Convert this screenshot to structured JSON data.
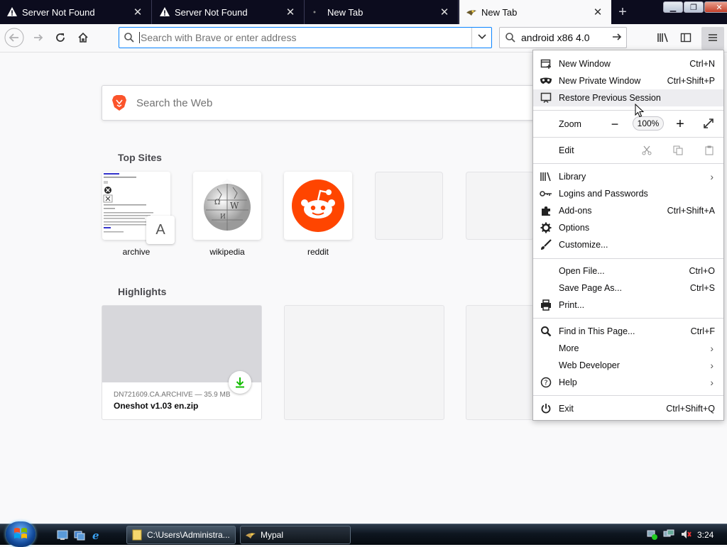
{
  "tabs": [
    {
      "title": "Server Not Found",
      "icon": "warning-icon",
      "active": false
    },
    {
      "title": "Server Not Found",
      "icon": "warning-icon",
      "active": false
    },
    {
      "title": "New Tab",
      "icon": "dot-icon",
      "active": false
    },
    {
      "title": "New Tab",
      "icon": "mypal-icon",
      "active": true
    }
  ],
  "urlbar": {
    "placeholder": "Search with Brave or enter address"
  },
  "searchbar": {
    "value": "android x86 4.0"
  },
  "newtab": {
    "websearch_placeholder": "Search the Web",
    "top_sites_heading": "Top Sites",
    "top_sites": [
      {
        "label": "archive",
        "badge": "A"
      },
      {
        "label": "wikipedia"
      },
      {
        "label": "reddit"
      },
      {
        "label": ""
      },
      {
        "label": ""
      }
    ],
    "highlights_heading": "Highlights",
    "highlight": {
      "meta": "DN721609.CA.ARCHIVE — 35.9 MB",
      "name": "Oneshot v1.03 en.zip"
    }
  },
  "menu": {
    "new_window": {
      "label": "New Window",
      "shortcut": "Ctrl+N"
    },
    "new_private": {
      "label": "New Private Window",
      "shortcut": "Ctrl+Shift+P"
    },
    "restore": {
      "label": "Restore Previous Session"
    },
    "zoom": {
      "label": "Zoom",
      "level": "100%"
    },
    "edit": {
      "label": "Edit"
    },
    "library": {
      "label": "Library"
    },
    "logins": {
      "label": "Logins and Passwords"
    },
    "addons": {
      "label": "Add-ons",
      "shortcut": "Ctrl+Shift+A"
    },
    "options": {
      "label": "Options"
    },
    "customize": {
      "label": "Customize..."
    },
    "open_file": {
      "label": "Open File...",
      "shortcut": "Ctrl+O"
    },
    "save_page": {
      "label": "Save Page As...",
      "shortcut": "Ctrl+S"
    },
    "print": {
      "label": "Print..."
    },
    "find": {
      "label": "Find in This Page...",
      "shortcut": "Ctrl+F"
    },
    "more": {
      "label": "More"
    },
    "webdev": {
      "label": "Web Developer"
    },
    "help": {
      "label": "Help"
    },
    "exit": {
      "label": "Exit",
      "shortcut": "Ctrl+Shift+Q"
    }
  },
  "taskbar": {
    "items": [
      {
        "label": "C:\\Users\\Administra..."
      },
      {
        "label": "Mypal"
      }
    ],
    "clock": "3:24"
  },
  "colors": {
    "accent": "#0a84ff",
    "reddit": "#ff4500",
    "download": "#12bc00"
  }
}
